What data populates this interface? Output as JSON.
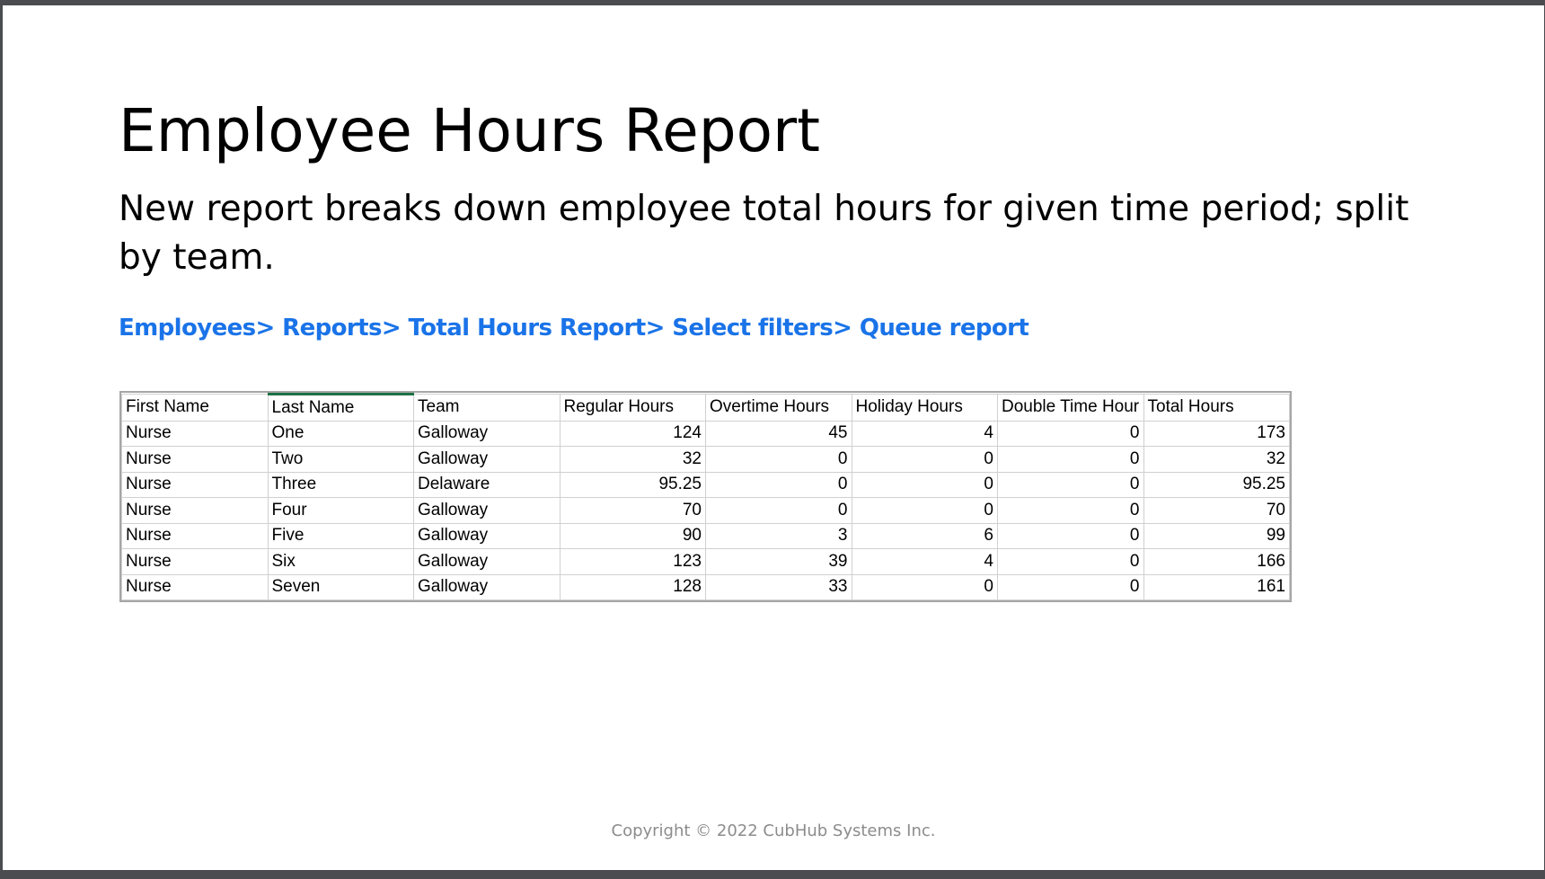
{
  "slide": {
    "title": "Employee Hours Report",
    "subtitle": "New report breaks down employee total hours for given time period; split by team.",
    "breadcrumb": [
      "Employees",
      "Reports",
      "Total Hours Report",
      "Select filters",
      "Queue report"
    ],
    "breadcrumb_separator": "> ",
    "link_color": "#1a73e8",
    "footer": "Copyright © 2022 CubHub Systems Inc."
  },
  "table": {
    "headers": [
      "First Name",
      "Last Name",
      "Team",
      "Regular Hours",
      "Overtime Hours",
      "Holiday Hours",
      "Double Time Hour",
      "Total Hours"
    ],
    "rows": [
      [
        "Nurse",
        "One",
        "Galloway",
        "124",
        "45",
        "4",
        "0",
        "173"
      ],
      [
        "Nurse",
        "Two",
        "Galloway",
        "32",
        "0",
        "0",
        "0",
        "32"
      ],
      [
        "Nurse",
        "Three",
        "Delaware",
        "95.25",
        "0",
        "0",
        "0",
        "95.25"
      ],
      [
        "Nurse",
        "Four",
        "Galloway",
        "70",
        "0",
        "0",
        "0",
        "70"
      ],
      [
        "Nurse",
        "Five",
        "Galloway",
        "90",
        "3",
        "6",
        "0",
        "99"
      ],
      [
        "Nurse",
        "Six",
        "Galloway",
        "123",
        "39",
        "4",
        "0",
        "166"
      ],
      [
        "Nurse",
        "Seven",
        "Galloway",
        "128",
        "33",
        "0",
        "0",
        "161"
      ]
    ]
  }
}
